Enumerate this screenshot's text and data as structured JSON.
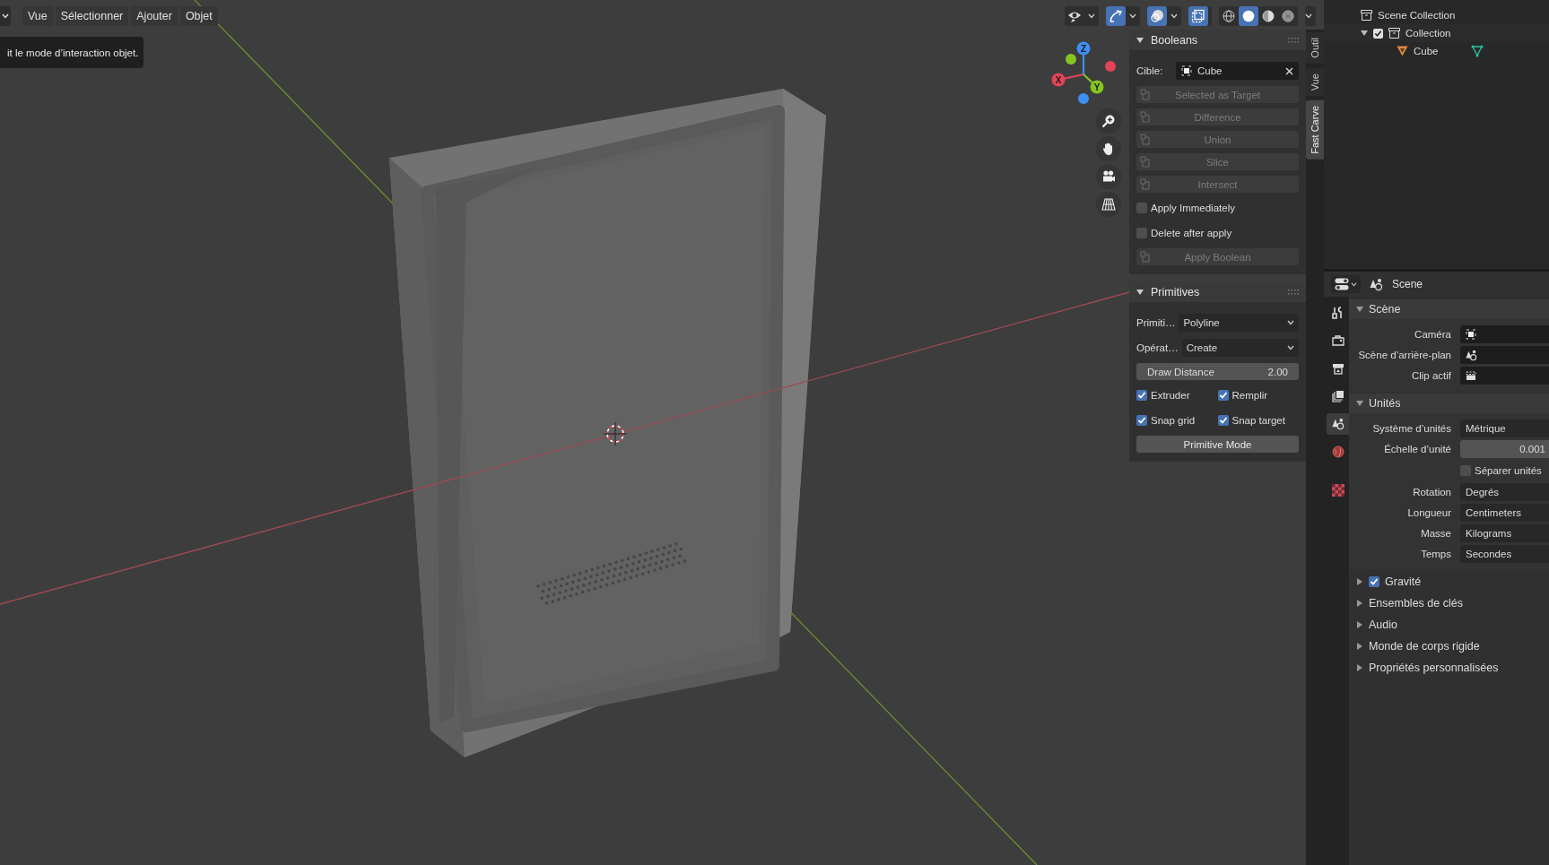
{
  "viewport": {
    "menus": [
      {
        "label": "Vue"
      },
      {
        "label": "Sélectionner"
      },
      {
        "label": "Ajouter"
      },
      {
        "label": "Objet"
      }
    ],
    "tooltip": {
      "text": "it le mode d’interaction objet."
    },
    "header_toggles": [
      {
        "kind": "visibility",
        "on": false
      },
      {
        "kind": "gizmo",
        "on": true
      },
      {
        "kind": "overlay",
        "on": true
      },
      {
        "kind": "xray",
        "on": true
      }
    ],
    "shading_modes": [
      {
        "kind": "wireframe",
        "selected": false
      },
      {
        "kind": "solid",
        "selected": true
      },
      {
        "kind": "material",
        "selected": false
      },
      {
        "kind": "rendered",
        "selected": false
      }
    ],
    "gizmo_axes": [
      {
        "label": "X",
        "color": "#e4435a"
      },
      {
        "label": "Y",
        "color": "#83c622"
      },
      {
        "label": "Z",
        "color": "#3d8ff2"
      }
    ]
  },
  "sidebar": {
    "tabs": [
      {
        "label": "Outil",
        "selected": false
      },
      {
        "label": "Vue",
        "selected": false
      },
      {
        "label": "Fast Carve",
        "selected": true
      }
    ],
    "panels": [
      {
        "title": "Booleans",
        "expanded": true,
        "items": [
          {
            "kind": "target",
            "label": "Cible:",
            "value": "Cube"
          },
          {
            "kind": "button",
            "label": "Selected as Target",
            "disabled": true
          },
          {
            "kind": "button",
            "label": "Difference",
            "disabled": true
          },
          {
            "kind": "button",
            "label": "Union",
            "disabled": true
          },
          {
            "kind": "button",
            "label": "Slice",
            "disabled": true
          },
          {
            "kind": "button",
            "label": "Intersect",
            "disabled": true
          },
          {
            "kind": "checkbox",
            "label": "Apply Immediately",
            "checked": false
          },
          {
            "kind": "checkbox",
            "label": "Delete after apply",
            "checked": false
          },
          {
            "kind": "button",
            "label": "Apply Boolean",
            "disabled": true
          }
        ]
      },
      {
        "title": "Primitives",
        "expanded": true,
        "items": [
          {
            "kind": "dropdown",
            "label": "Primiti…",
            "value": "Polyline"
          },
          {
            "kind": "dropdown",
            "label": "Opérat…",
            "value": "Create"
          },
          {
            "kind": "number",
            "label": "Draw Distance",
            "value": "2.00"
          },
          {
            "kind": "checkboxes",
            "checkboxes": [
              {
                "label": "Extruder",
                "checked": true
              },
              {
                "label": "Remplir",
                "checked": true
              }
            ]
          },
          {
            "kind": "checkboxes",
            "checkboxes": [
              {
                "label": "Snap grid",
                "checked": true
              },
              {
                "label": "Snap target",
                "checked": true
              }
            ]
          },
          {
            "kind": "button",
            "label": "Primitive Mode",
            "disabled": false
          }
        ]
      }
    ]
  },
  "outliner": {
    "tree": [
      {
        "label": "Scene Collection",
        "kind": "scene_collection",
        "children": [
          {
            "label": "Collection",
            "kind": "collection",
            "checked": true,
            "expanded": true,
            "children": [
              {
                "label": "Cube",
                "kind": "mesh_object"
              }
            ]
          }
        ]
      }
    ]
  },
  "properties": {
    "header": {
      "title": "Scene"
    },
    "tabs": [
      {
        "kind": "tool",
        "selected": false
      },
      {
        "kind": "render",
        "selected": false
      },
      {
        "kind": "output",
        "selected": false
      },
      {
        "kind": "view_layer",
        "selected": false
      },
      {
        "kind": "scene",
        "selected": true
      },
      {
        "kind": "world",
        "selected": false
      },
      {
        "kind": "texture",
        "selected": false
      }
    ],
    "sections": [
      {
        "title": "Scène",
        "expanded": true,
        "rows": [
          {
            "kind": "object_field",
            "label": "Caméra"
          },
          {
            "kind": "scene_field",
            "label": "Scène d’arrière-plan"
          },
          {
            "kind": "clip_field",
            "label": "Clip actif"
          }
        ]
      },
      {
        "title": "Unités",
        "expanded": true,
        "rows": [
          {
            "kind": "dropdown",
            "label": "Système d’unités",
            "value": "Métrique"
          },
          {
            "kind": "number",
            "label": "Échelle d’unité",
            "value": "0.001"
          },
          {
            "kind": "checkbox",
            "label": "Séparer unités",
            "checked": false
          },
          {
            "kind": "dropdown",
            "label": "Rotation",
            "value": "Degrés"
          },
          {
            "kind": "dropdown",
            "label": "Longueur",
            "value": "Centimeters"
          },
          {
            "kind": "dropdown",
            "label": "Masse",
            "value": "Kilograms"
          },
          {
            "kind": "dropdown",
            "label": "Temps",
            "value": "Secondes"
          }
        ]
      },
      {
        "title": "Gravité",
        "expanded": false,
        "checked": true
      },
      {
        "title": "Ensembles de clés",
        "expanded": false
      },
      {
        "title": "Audio",
        "expanded": false
      },
      {
        "title": "Monde de corps rigide",
        "expanded": false
      },
      {
        "title": "Propriétés personnalisées",
        "expanded": false
      }
    ]
  }
}
